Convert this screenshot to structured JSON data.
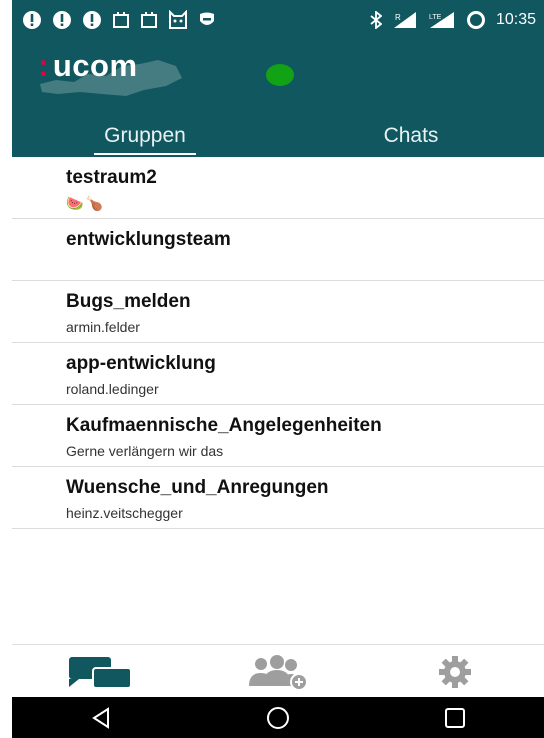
{
  "status_bar": {
    "time": "10:35",
    "left_icons": [
      "alert-icon",
      "alert-icon",
      "alert-icon",
      "calendar-icon",
      "calendar-icon",
      "cat-icon",
      "shield-icon"
    ],
    "right_icons": [
      "bluetooth-icon",
      "signal-r-icon",
      "signal-lte-icon",
      "ring-icon"
    ],
    "signal_labels": {
      "roaming": "R",
      "lte": "LTE"
    }
  },
  "header": {
    "logo_colon": ":",
    "logo_text": "ucom",
    "presence_color": "#12a216"
  },
  "tabs": [
    {
      "label": "Gruppen",
      "active": true
    },
    {
      "label": "Chats",
      "active": false
    }
  ],
  "groups": [
    {
      "name": "testraum2",
      "subtitle": "",
      "emoji": [
        "🍉",
        "🍗"
      ]
    },
    {
      "name": "entwicklungsteam",
      "subtitle": ""
    },
    {
      "name": "Bugs_melden",
      "subtitle": "armin.felder"
    },
    {
      "name": "app-entwicklung",
      "subtitle": "roland.ledinger"
    },
    {
      "name": "Kaufmaennische_Angelegenheiten",
      "subtitle": "Gerne verlängern wir das"
    },
    {
      "name": "Wuensche_und_Anregungen",
      "subtitle": "heinz.veitschegger"
    }
  ],
  "bottom_nav": [
    "chats-icon",
    "add-group-icon",
    "settings-icon"
  ],
  "colors": {
    "primary": "#10575f",
    "accent": "#e6003e",
    "nav_active": "#10575f",
    "nav_inactive": "#9e9e9e"
  }
}
